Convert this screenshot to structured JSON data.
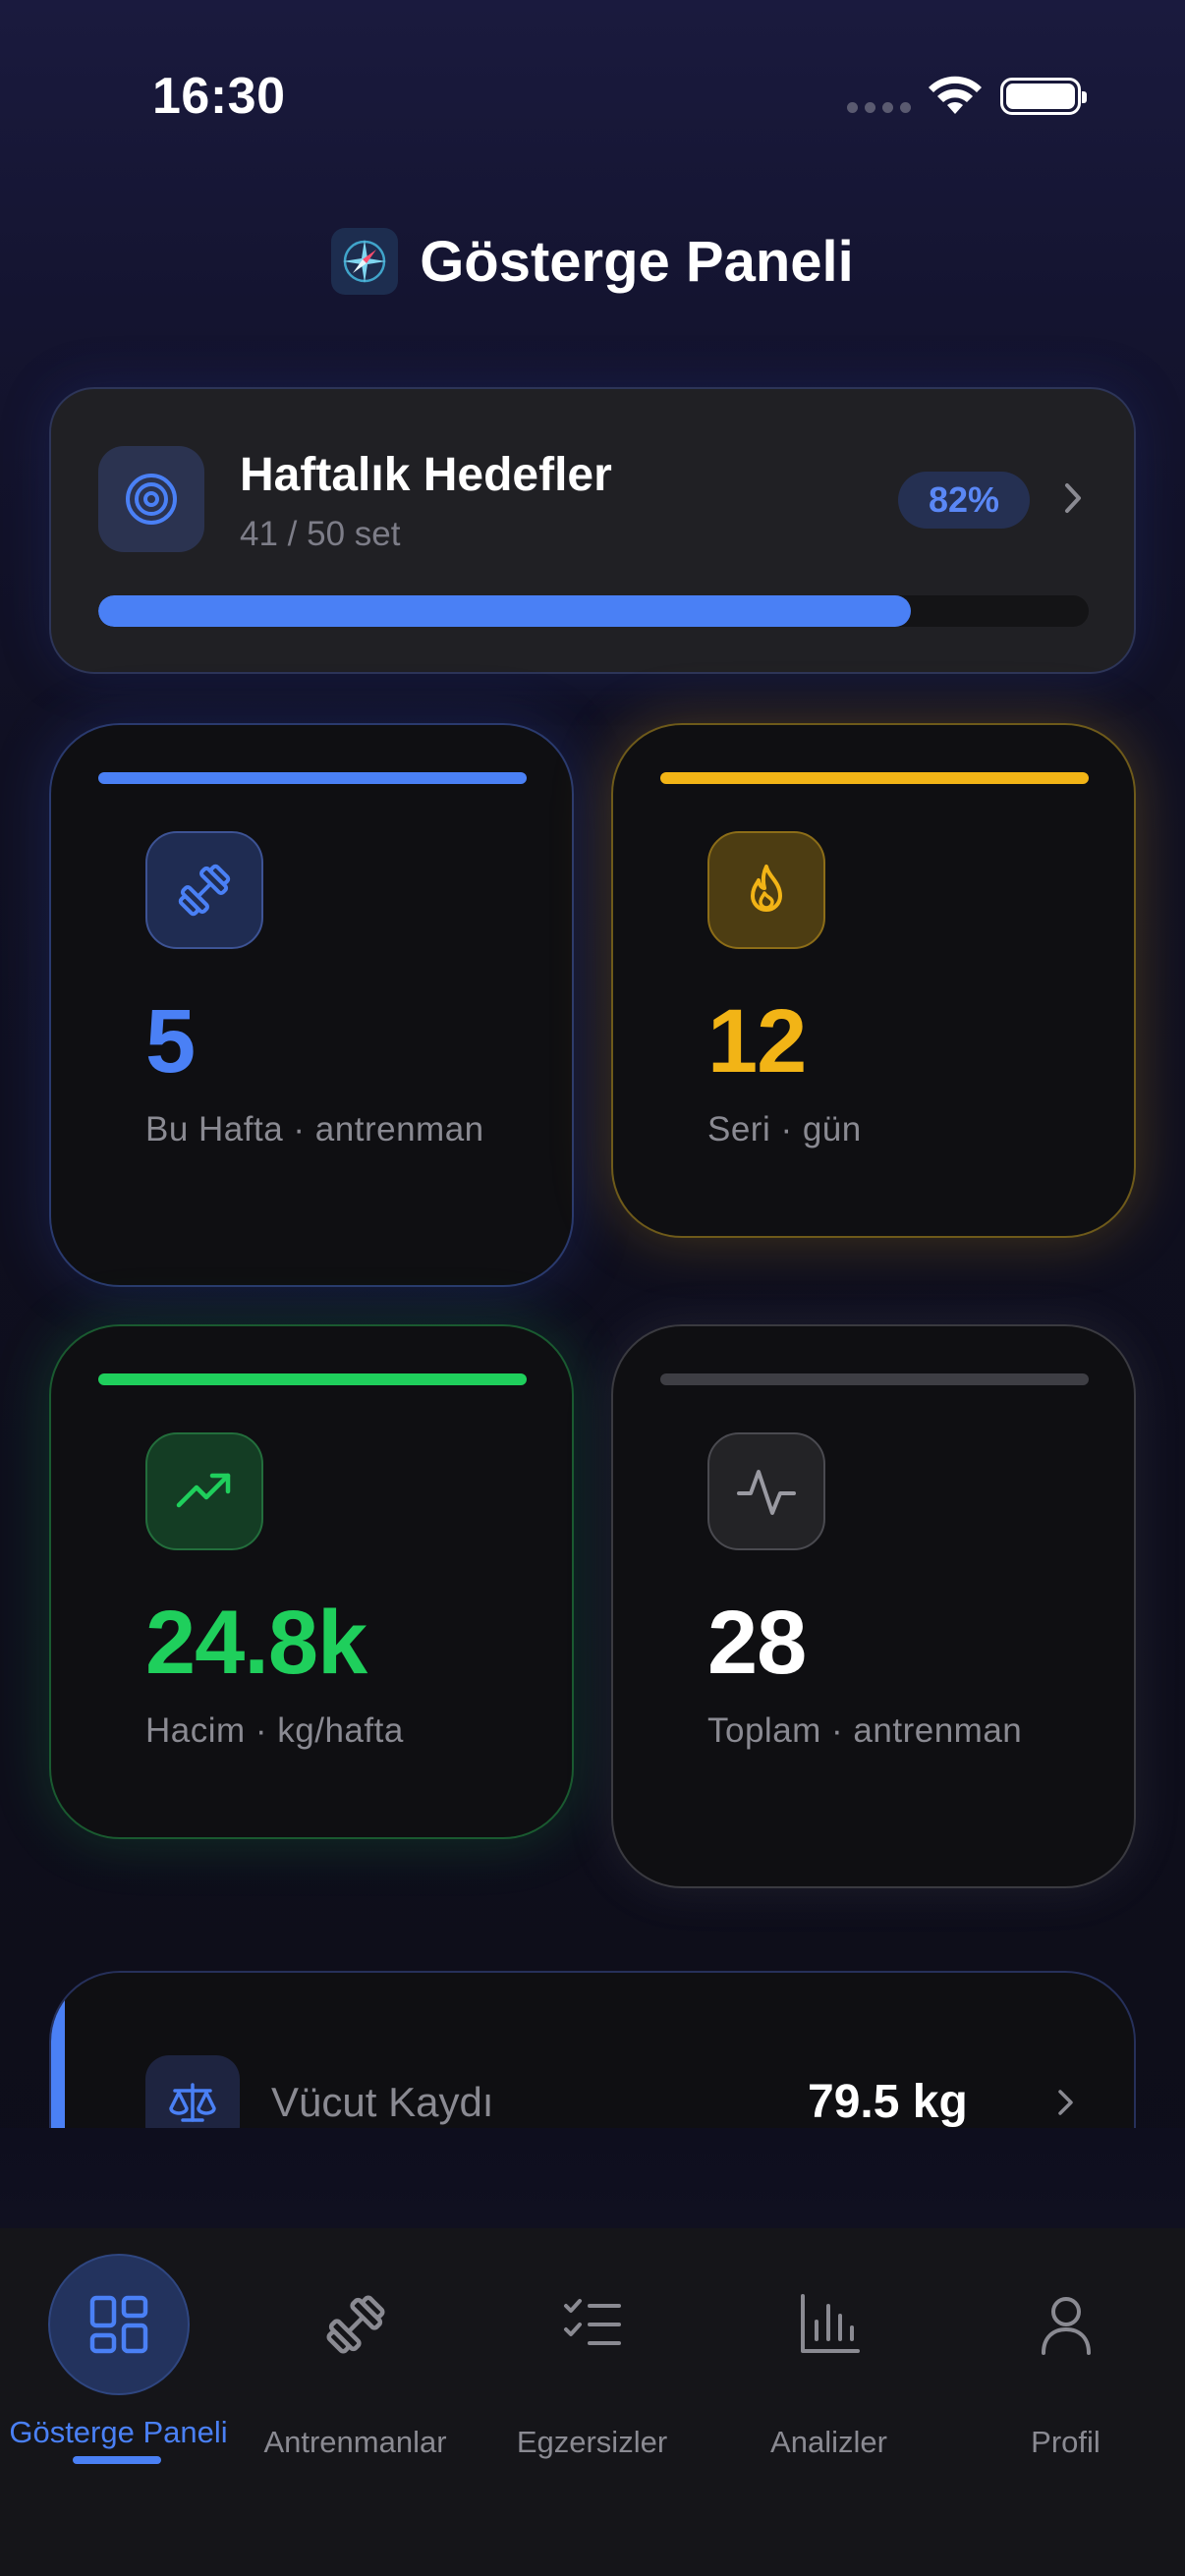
{
  "status_bar": {
    "time": "16:30"
  },
  "header": {
    "title": "Gösterge Paneli",
    "logo_icon": "compass-icon"
  },
  "goals": {
    "title": "Haftalık Hedefler",
    "subtitle": "41 / 50 set",
    "percent_label": "82%",
    "progress": 0.82,
    "icon": "target-icon"
  },
  "stats": [
    {
      "value": "5",
      "label": "Bu Hafta · antrenman",
      "color": "#4a80f5",
      "icon": "dumbbell-icon"
    },
    {
      "value": "12",
      "label": "Seri · gün",
      "color": "#f2b416",
      "icon": "flame-icon"
    },
    {
      "value": "24.8k",
      "label": "Hacim · kg/hafta",
      "color": "#1fcf5c",
      "icon": "trending-up-icon"
    },
    {
      "value": "28",
      "label": "Toplam · antrenman",
      "color": "#ffffff",
      "icon": "activity-icon"
    }
  ],
  "body_record": {
    "label": "Vücut Kaydı",
    "value": "79.5 kg",
    "icon": "scale-icon"
  },
  "tabs": [
    {
      "label": "Gösterge Paneli",
      "icon": "grid-icon",
      "active": true
    },
    {
      "label": "Antrenmanlar",
      "icon": "dumbbell-icon",
      "active": false
    },
    {
      "label": "Egzersizler",
      "icon": "checklist-icon",
      "active": false
    },
    {
      "label": "Analizler",
      "icon": "bar-chart-icon",
      "active": false
    },
    {
      "label": "Profil",
      "icon": "user-icon",
      "active": false
    }
  ],
  "colors": {
    "accent": "#4a80f5",
    "streak": "#f2b416",
    "volume": "#1fcf5c"
  }
}
